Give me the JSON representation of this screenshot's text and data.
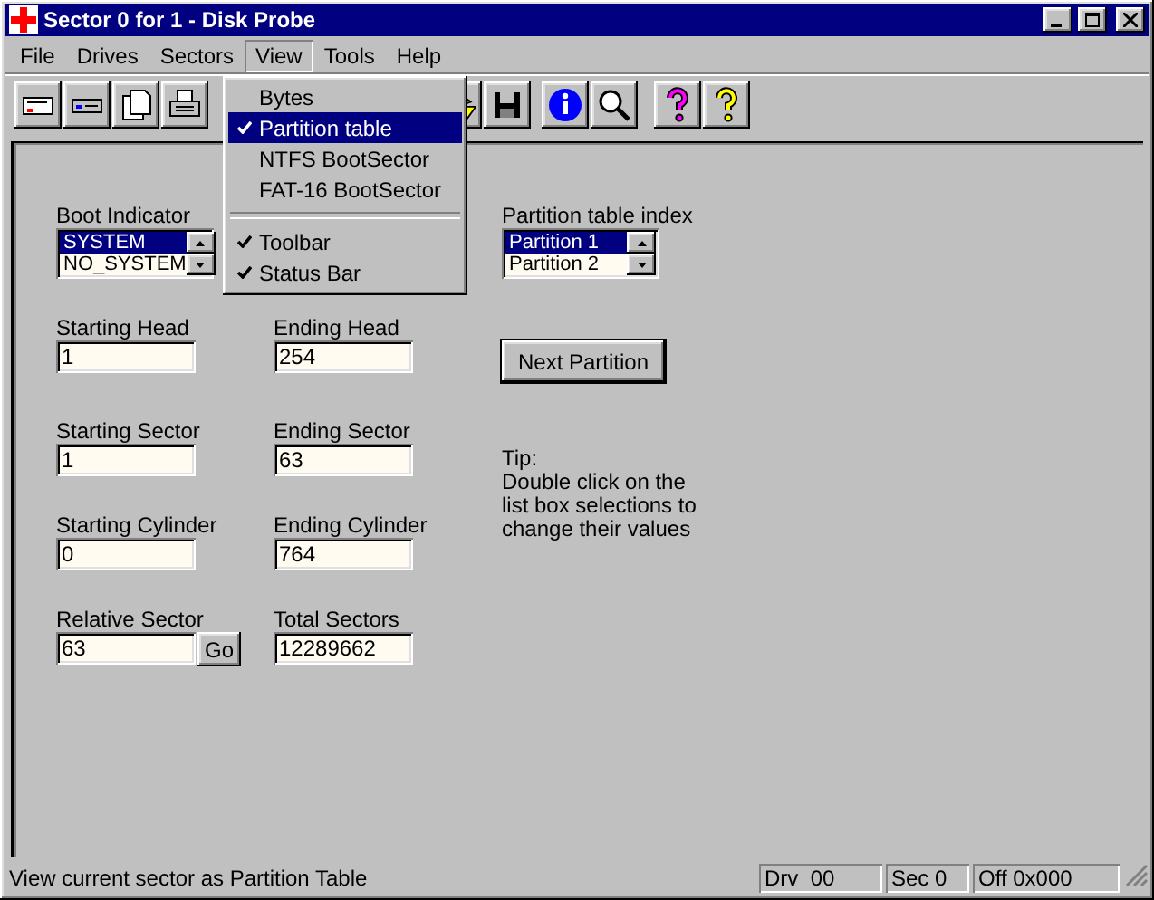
{
  "window": {
    "title": "Sector 0 for 1 - Disk Probe"
  },
  "menu_bar": [
    {
      "label": "File",
      "selected": false
    },
    {
      "label": "Drives",
      "selected": false
    },
    {
      "label": "Sectors",
      "selected": false
    },
    {
      "label": "View",
      "selected": true
    },
    {
      "label": "Tools",
      "selected": false
    },
    {
      "label": "Help",
      "selected": false
    }
  ],
  "open_menu": {
    "items": [
      {
        "kind": "item",
        "label": "Bytes",
        "checked": false,
        "selected": false
      },
      {
        "kind": "item",
        "label": "Partition table",
        "checked": true,
        "selected": true
      },
      {
        "kind": "item",
        "label": "NTFS BootSector",
        "checked": false,
        "selected": false
      },
      {
        "kind": "item",
        "label": "FAT-16 BootSector",
        "checked": false,
        "selected": false
      },
      {
        "kind": "separator"
      },
      {
        "kind": "item",
        "label": "Toolbar",
        "checked": true,
        "selected": false
      },
      {
        "kind": "item",
        "label": "Status Bar",
        "checked": true,
        "selected": false
      }
    ]
  },
  "boot_indicator": {
    "label": "Boot Indicator",
    "options": [
      {
        "text": "SYSTEM",
        "selected": true
      },
      {
        "text": "NO_SYSTEM",
        "selected": false
      }
    ]
  },
  "partition_index": {
    "label": "Partition table index",
    "options": [
      {
        "text": "Partition 1",
        "selected": true
      },
      {
        "text": "Partition 2",
        "selected": false
      }
    ]
  },
  "fields": [
    {
      "label": "Starting Head",
      "value": "1"
    },
    {
      "label": "Ending Head",
      "value": "254"
    },
    {
      "label": "Starting Sector",
      "value": "1"
    },
    {
      "label": "Ending Sector",
      "value": "63"
    },
    {
      "label": "Starting Cylinder",
      "value": "0"
    },
    {
      "label": "Ending Cylinder",
      "value": "764"
    },
    {
      "label": "Relative Sector",
      "value": "63"
    },
    {
      "label": "Total Sectors",
      "value": "12289662"
    }
  ],
  "go_button": "Go",
  "next_button": "Next Partition",
  "tip": {
    "title": "Tip:",
    "text": "Double click on the list box selections to change their values"
  },
  "status_bar": {
    "message": "View current sector as Partition Table",
    "panels": [
      "Drv  00",
      "Sec 0",
      "Off 0x000"
    ]
  }
}
